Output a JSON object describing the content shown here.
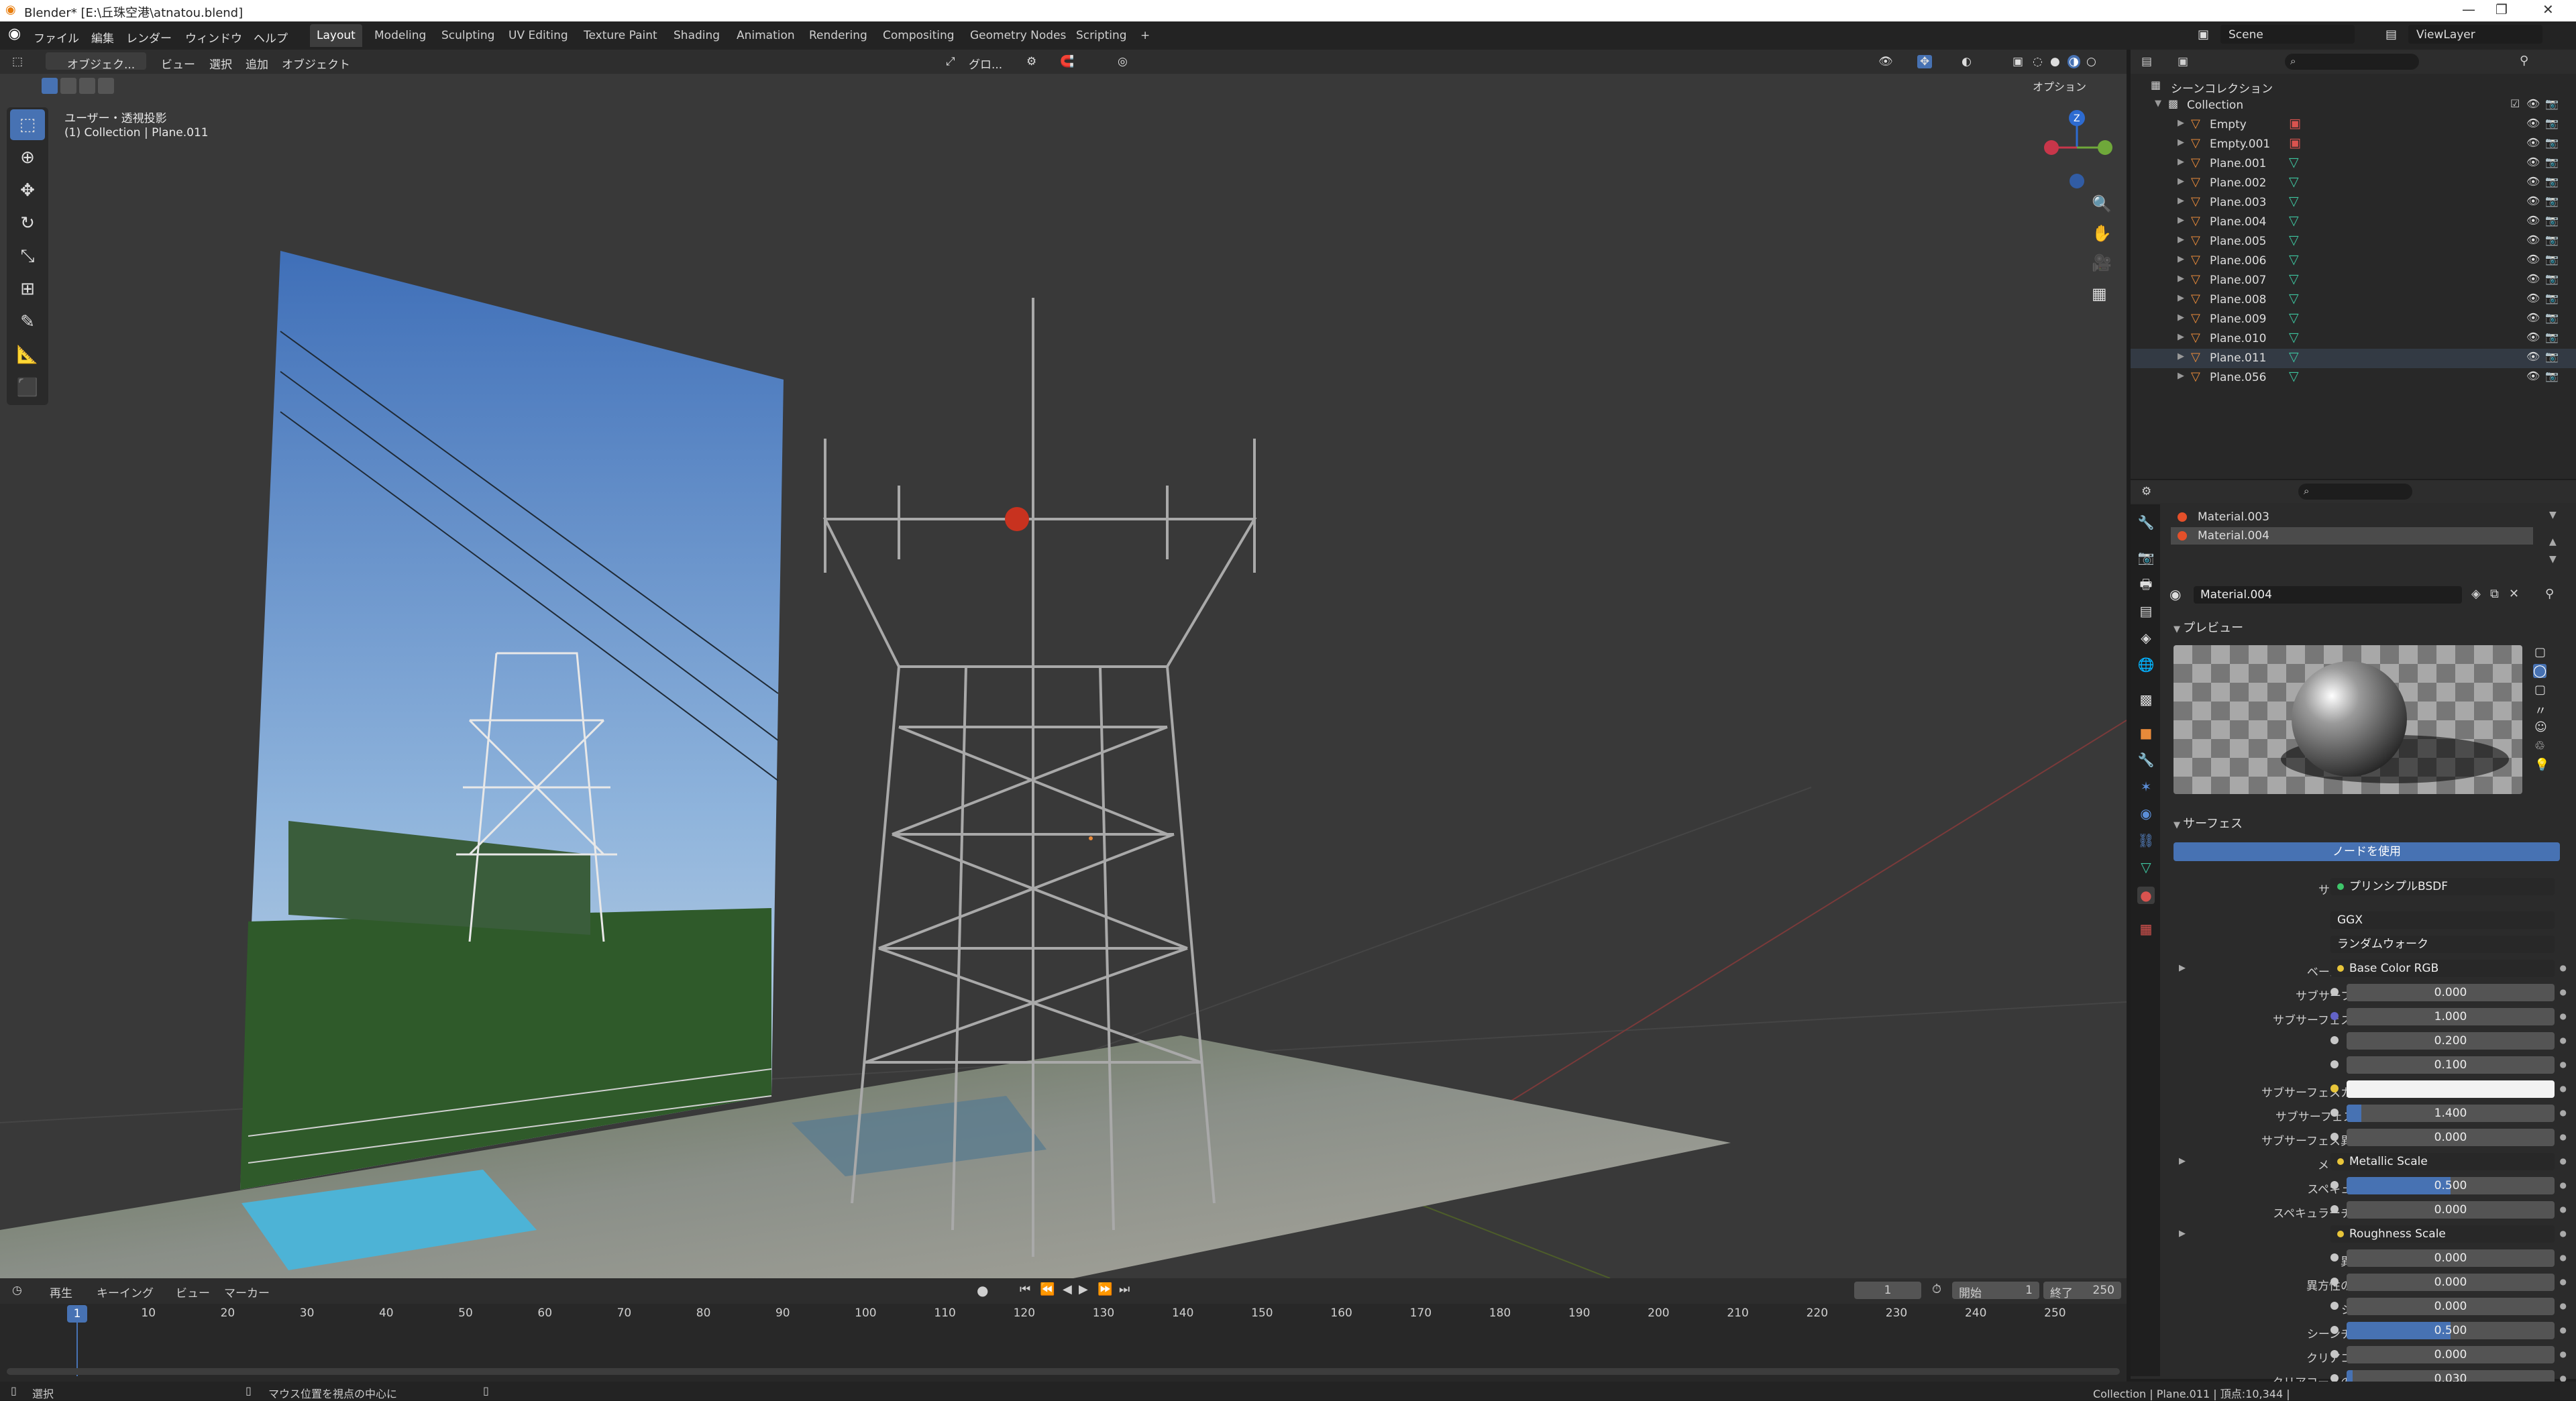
{
  "window": {
    "title": "Blender* [E:\\丘珠空港\\atnatou.blend]",
    "minimize": "—",
    "maximize": "❐",
    "close": "✕"
  },
  "menu": {
    "items": [
      "ファイル",
      "編集",
      "レンダー",
      "ウィンドウ",
      "ヘルプ"
    ],
    "workspaces": [
      "Layout",
      "Modeling",
      "Sculpting",
      "UV Editing",
      "Texture Paint",
      "Shading",
      "Animation",
      "Rendering",
      "Compositing",
      "Geometry Nodes",
      "Scripting"
    ],
    "active_workspace": "Layout",
    "add_tab": "+",
    "scene": "Scene",
    "view_layer": "ViewLayer"
  },
  "viewport_header": {
    "mode": "オブジェク...",
    "view": "ビュー",
    "select": "選択",
    "add": "追加",
    "object": "オブジェクト",
    "transform": "グロ...",
    "options": "オプション"
  },
  "viewport": {
    "overlay_title": "ユーザー・透視投影",
    "overlay_sub": "(1) Collection | Plane.011",
    "gizmo_z": "Z"
  },
  "outliner": {
    "root": "シーンコレクション",
    "collection": "Collection",
    "items": [
      {
        "name": "Empty",
        "kind": "empty"
      },
      {
        "name": "Empty.001",
        "kind": "empty"
      },
      {
        "name": "Plane.001",
        "kind": "mesh"
      },
      {
        "name": "Plane.002",
        "kind": "mesh"
      },
      {
        "name": "Plane.003",
        "kind": "mesh"
      },
      {
        "name": "Plane.004",
        "kind": "mesh"
      },
      {
        "name": "Plane.005",
        "kind": "mesh"
      },
      {
        "name": "Plane.006",
        "kind": "mesh"
      },
      {
        "name": "Plane.007",
        "kind": "mesh"
      },
      {
        "name": "Plane.008",
        "kind": "mesh"
      },
      {
        "name": "Plane.009",
        "kind": "mesh"
      },
      {
        "name": "Plane.010",
        "kind": "mesh"
      },
      {
        "name": "Plane.011",
        "kind": "mesh"
      },
      {
        "name": "Plane.056",
        "kind": "mesh"
      }
    ]
  },
  "materials": {
    "slots": [
      "Material.003",
      "Material.004"
    ],
    "active": "Material.004",
    "datablock": "Material.004"
  },
  "properties": {
    "preview_label": "プレビュー",
    "surface_label": "サーフェス",
    "use_nodes": "ノードを使用",
    "surface_field_label": "サーフェス",
    "surface_field": "プリンシプルBSDF",
    "distribution": "GGX",
    "subsurface_method": "ランダムウォーク",
    "rows": [
      {
        "label": "ベースカラー",
        "value": "Base Color RGB",
        "node": true,
        "expand": true
      },
      {
        "label": "サブサーフェス",
        "value": "0.000"
      },
      {
        "label": "サブサーフェス範囲",
        "value": "1.000",
        "vec": true
      },
      {
        "label": "",
        "value": "0.200"
      },
      {
        "label": "",
        "value": "0.100"
      },
      {
        "label": "サブサーフェスカラー",
        "value": "",
        "white": true
      },
      {
        "label": "サブサーフェスIOR",
        "value": "1.400",
        "fill": 0.07
      },
      {
        "label": "サブサーフェス異方性",
        "value": "0.000"
      },
      {
        "label": "メタリック",
        "value": "Metallic Scale",
        "node": true,
        "expand": true
      },
      {
        "label": "スペキュラー",
        "value": "0.500",
        "fill": 0.5
      },
      {
        "label": "スペキュラーチント",
        "value": "0.000"
      },
      {
        "label": "粗さ",
        "value": "Roughness Scale",
        "node": true,
        "expand": true
      },
      {
        "label": "異方性",
        "value": "0.000"
      },
      {
        "label": "異方性の回転",
        "value": "0.000"
      },
      {
        "label": "シーン",
        "value": "0.000"
      },
      {
        "label": "シーンチント",
        "value": "0.500",
        "fill": 0.5
      },
      {
        "label": "クリアコート",
        "value": "0.000"
      },
      {
        "label": "クリアコートの粗さ",
        "value": "0.030",
        "fill": 0.03
      }
    ]
  },
  "timeline": {
    "playback": "再生",
    "keying": "キーイング",
    "view": "ビュー",
    "marker": "マーカー",
    "current_frame": "1",
    "start_label": "開始",
    "start": "1",
    "end_label": "終了",
    "end": "250",
    "ruler": [
      "10",
      "20",
      "30",
      "40",
      "50",
      "60",
      "70",
      "80",
      "90",
      "100",
      "110",
      "120",
      "130",
      "140",
      "150",
      "160",
      "170",
      "180",
      "190",
      "200",
      "210",
      "220",
      "230",
      "240",
      "250"
    ],
    "playhead": "1"
  },
  "status": {
    "left": "選択",
    "middle": "マウス位置を視点の中心に",
    "right": "Collection | Plane.011 | 頂点:10,344 |"
  },
  "colors": {
    "accent": "#4772b3",
    "viewport_bg": "#393939",
    "mesh_icon": "#3ec6a0",
    "object_icon": "#e88a3a"
  }
}
